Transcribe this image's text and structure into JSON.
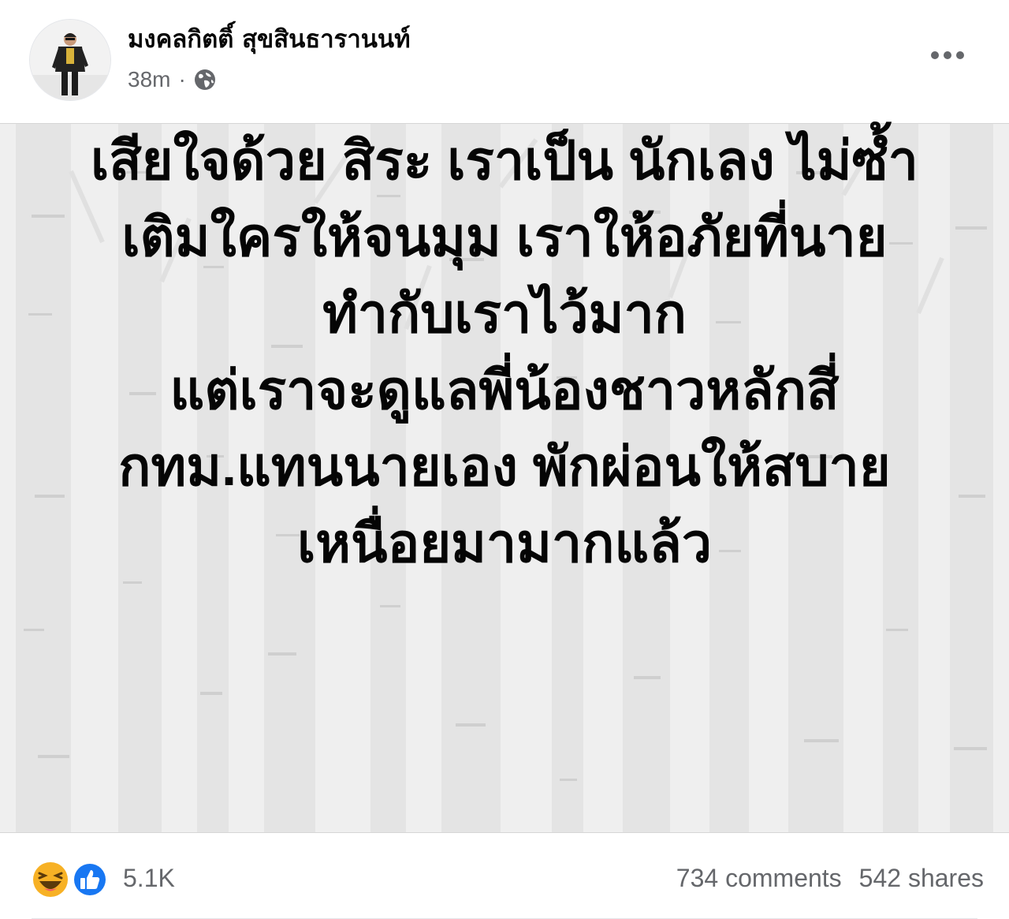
{
  "header": {
    "author_name": "มงคลกิตติ์ สุขสินธารานนท์",
    "timestamp": "38m",
    "separator": "·",
    "privacy_icon": "globe-icon",
    "more_icon": "more-horizontal-icon"
  },
  "post": {
    "text_lines": [
      "เสียใจด้วย สิระ เราเป็น นักเลง ไม่ซ้ำ",
      "เติมใครให้จนมุม เราให้อภัยที่นาย",
      "ทำกับเราไว้มาก",
      "แต่เราจะดูแลพี่น้องชาวหลักสี่",
      "กทม.แทนนายเอง พักผ่อนให้สบาย",
      "เหนื่อยมามากแล้ว"
    ],
    "background_color": "#efefef",
    "text_color": "#050505"
  },
  "footer": {
    "reaction_icons": [
      "haha-reaction-icon",
      "like-reaction-icon"
    ],
    "reaction_count": "5.1K",
    "comments": "734 comments",
    "shares": "542 shares"
  },
  "colors": {
    "secondary_text": "#65676b",
    "like_blue": "#1877f2",
    "haha_yellow": "#f7b125"
  }
}
